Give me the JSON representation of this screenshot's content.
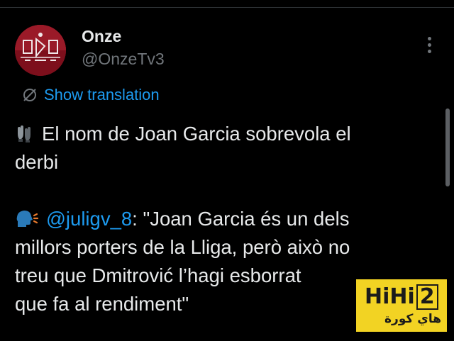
{
  "tweet": {
    "author": {
      "display_name": "Onze",
      "handle": "@OnzeTv3"
    },
    "translate_label": "Show translation",
    "lines": {
      "line1": "El nom de Joan Garcia sobrevola el",
      "line2": "derbi",
      "line4_mention": "@juligv_8",
      "line4_text": ": \"Joan Garcia és un dels",
      "line5": "millors porters de la Lliga, però això no",
      "line6": "treu que Dmitrović l’hagi esborrat",
      "line7": "que fa al rendiment\""
    },
    "emojis": [
      "gloves-emoji",
      "speaking-head-emoji"
    ]
  },
  "watermark": {
    "brand_text": "HiHi",
    "brand_number": "2",
    "arabic_text": "هاي كورة"
  },
  "colors": {
    "background": "#000000",
    "text": "#e7e9ea",
    "muted": "#71767b",
    "link": "#1d9bf0",
    "watermark_bg": "#f2d323"
  }
}
